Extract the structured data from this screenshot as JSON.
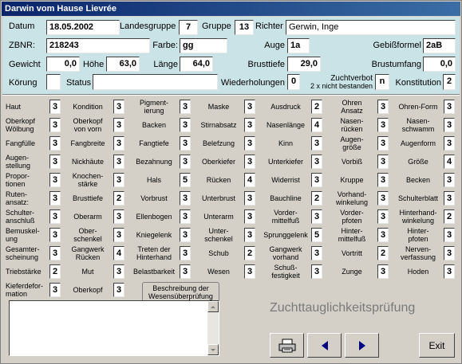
{
  "window": {
    "title": "Darwin vom Hause Lievrée"
  },
  "header": {
    "datum": {
      "label": "Datum",
      "value": "18.05.2002"
    },
    "landesgruppe": {
      "label": "Landesgruppe",
      "value": "7"
    },
    "gruppe": {
      "label": "Gruppe",
      "value": "13"
    },
    "richter": {
      "label": "Richter",
      "value": "Gerwin, Inge"
    },
    "zbnr": {
      "label": "ZBNR:",
      "value": "218243"
    },
    "farbe": {
      "label": "Farbe:",
      "value": "gg"
    },
    "auge": {
      "label": "Auge",
      "value": "1a"
    },
    "gebissformel": {
      "label": "Gebißformel",
      "value": "2aB"
    },
    "gewicht": {
      "label": "Gewicht",
      "value": "0,0"
    },
    "hoehe": {
      "label": "Höhe",
      "value": "63,0"
    },
    "laenge": {
      "label": "Länge",
      "value": "64,0"
    },
    "brusttiefe": {
      "label": "Brusttiefe",
      "value": "29,0"
    },
    "brustumfang": {
      "label": "Brustumfang",
      "value": "0,0"
    },
    "koerung": {
      "label": "Körung",
      "value": ""
    },
    "status": {
      "label": "Status",
      "value": ""
    },
    "wiederholungen": {
      "label": "Wiederholungen",
      "value": "0"
    },
    "zuchtverbot": {
      "label": "Zuchtverbot",
      "sublabel": "2 x nicht bestanden",
      "value": "n"
    },
    "konstitution": {
      "label": "Konstitution",
      "value": "2"
    }
  },
  "grades": [
    [
      {
        "label": "Haut",
        "value": "3"
      },
      {
        "label": "Oberkopf\nWölbung",
        "value": "3"
      },
      {
        "label": "Fangfülle",
        "value": "3"
      },
      {
        "label": "Augen-\nstellung",
        "value": "3"
      },
      {
        "label": "Propor-\ntionen",
        "value": "3"
      },
      {
        "label": "Ruten-\nansatz:",
        "value": "3"
      },
      {
        "label": "Schulter-\nanschluß",
        "value": "3"
      },
      {
        "label": "Bemuskel-\nung",
        "value": "3"
      },
      {
        "label": "Gesamter-\nscheinung",
        "value": "3"
      },
      {
        "label": "Triebstärke",
        "value": "2"
      },
      {
        "label": "Kieferdefor-\nmation",
        "value": "3"
      }
    ],
    [
      {
        "label": "Kondition",
        "value": "3"
      },
      {
        "label": "Oberkopf\nvon vorn",
        "value": "3"
      },
      {
        "label": "Fangbreite",
        "value": "3"
      },
      {
        "label": "Nickhäute",
        "value": "3"
      },
      {
        "label": "Knochen-\nstärke",
        "value": "3"
      },
      {
        "label": "Brusttiefe",
        "value": "2"
      },
      {
        "label": "Oberarm",
        "value": "3"
      },
      {
        "label": "Ober-\nschenkel",
        "value": "3"
      },
      {
        "label": "Gangwerk\nRücken",
        "value": "4"
      },
      {
        "label": "Mut",
        "value": "3"
      },
      {
        "label": "Oberkopf",
        "value": "3"
      }
    ],
    [
      {
        "label": "Pigment-\nierung",
        "value": "3"
      },
      {
        "label": "Backen",
        "value": "3"
      },
      {
        "label": "Fangtiefe",
        "value": "3"
      },
      {
        "label": "Bezahnung",
        "value": "3"
      },
      {
        "label": "Hals",
        "value": "5"
      },
      {
        "label": "Vorbrust",
        "value": "3"
      },
      {
        "label": "Ellenbogen",
        "value": "3"
      },
      {
        "label": "Kniegelenk",
        "value": "3"
      },
      {
        "label": "Treten der\nHinterhand",
        "value": "3"
      },
      {
        "label": "Belastbarkeit",
        "value": "3"
      }
    ],
    [
      {
        "label": "Maske",
        "value": "3"
      },
      {
        "label": "Stirnabsatz",
        "value": "3"
      },
      {
        "label": "Belefzung",
        "value": "3"
      },
      {
        "label": "Oberkiefer",
        "value": "3"
      },
      {
        "label": "Rücken",
        "value": "4"
      },
      {
        "label": "Unterbrust",
        "value": "3"
      },
      {
        "label": "Unterarm",
        "value": "3"
      },
      {
        "label": "Unter-\nschenkel",
        "value": "3"
      },
      {
        "label": "Schub",
        "value": "2"
      },
      {
        "label": "Wesen",
        "value": "3"
      }
    ],
    [
      {
        "label": "Ausdruck",
        "value": "2"
      },
      {
        "label": "Nasenlänge",
        "value": "4"
      },
      {
        "label": "Kinn",
        "value": "3"
      },
      {
        "label": "Unterkiefer",
        "value": "3"
      },
      {
        "label": "Widerrist",
        "value": "3"
      },
      {
        "label": "Bauchline",
        "value": "2"
      },
      {
        "label": "Vorder-\nmittelfuß",
        "value": "3"
      },
      {
        "label": "Sprunggelenk",
        "value": "5"
      },
      {
        "label": "Gangwerk\nvorhand",
        "value": "3"
      },
      {
        "label": "Schuß-\nfestigkeit",
        "value": "3"
      }
    ],
    [
      {
        "label": "Ohren\nAnsatz",
        "value": "3"
      },
      {
        "label": "Nasen-\nrücken",
        "value": "3"
      },
      {
        "label": "Augen-\ngröße",
        "value": "3"
      },
      {
        "label": "Vorbiß",
        "value": "3"
      },
      {
        "label": "Kruppe",
        "value": "3"
      },
      {
        "label": "Vorhand-\nwinkelung",
        "value": "3"
      },
      {
        "label": "Vorder-\npfoten",
        "value": "3"
      },
      {
        "label": "Hinter-\nmittelfuß",
        "value": "3"
      },
      {
        "label": "Vortritt",
        "value": "2"
      },
      {
        "label": "Zunge",
        "value": "3"
      }
    ],
    [
      {
        "label": "Ohren-Form",
        "value": "3"
      },
      {
        "label": "Nasen-\nschwamm",
        "value": "3"
      },
      {
        "label": "Augenform",
        "value": "3"
      },
      {
        "label": "Größe",
        "value": "4"
      },
      {
        "label": "Becken",
        "value": "3"
      },
      {
        "label": "Schulterblatt",
        "value": "3"
      },
      {
        "label": "Hinterhand-\nwinkelung",
        "value": "2"
      },
      {
        "label": "Hinter-\npfoten",
        "value": "3"
      },
      {
        "label": "Nerven-\nverfassung",
        "value": "3"
      },
      {
        "label": "Hoden",
        "value": "3"
      }
    ]
  ],
  "description_tab": {
    "label": "Beschreibung der\nWesensüberprüfung"
  },
  "memo": {
    "value": ""
  },
  "zucht_label": "Zuchttauglichkeitsprüfung",
  "buttons": {
    "exit": "Exit"
  },
  "icons": {
    "print": "printer-icon",
    "prev": "left-arrow-icon",
    "next": "right-arrow-icon"
  },
  "colors": {
    "header_bg": "#c9e3e6",
    "title_start": "#0a246a",
    "title_end": "#3a6ea5",
    "arrow": "#000080"
  }
}
